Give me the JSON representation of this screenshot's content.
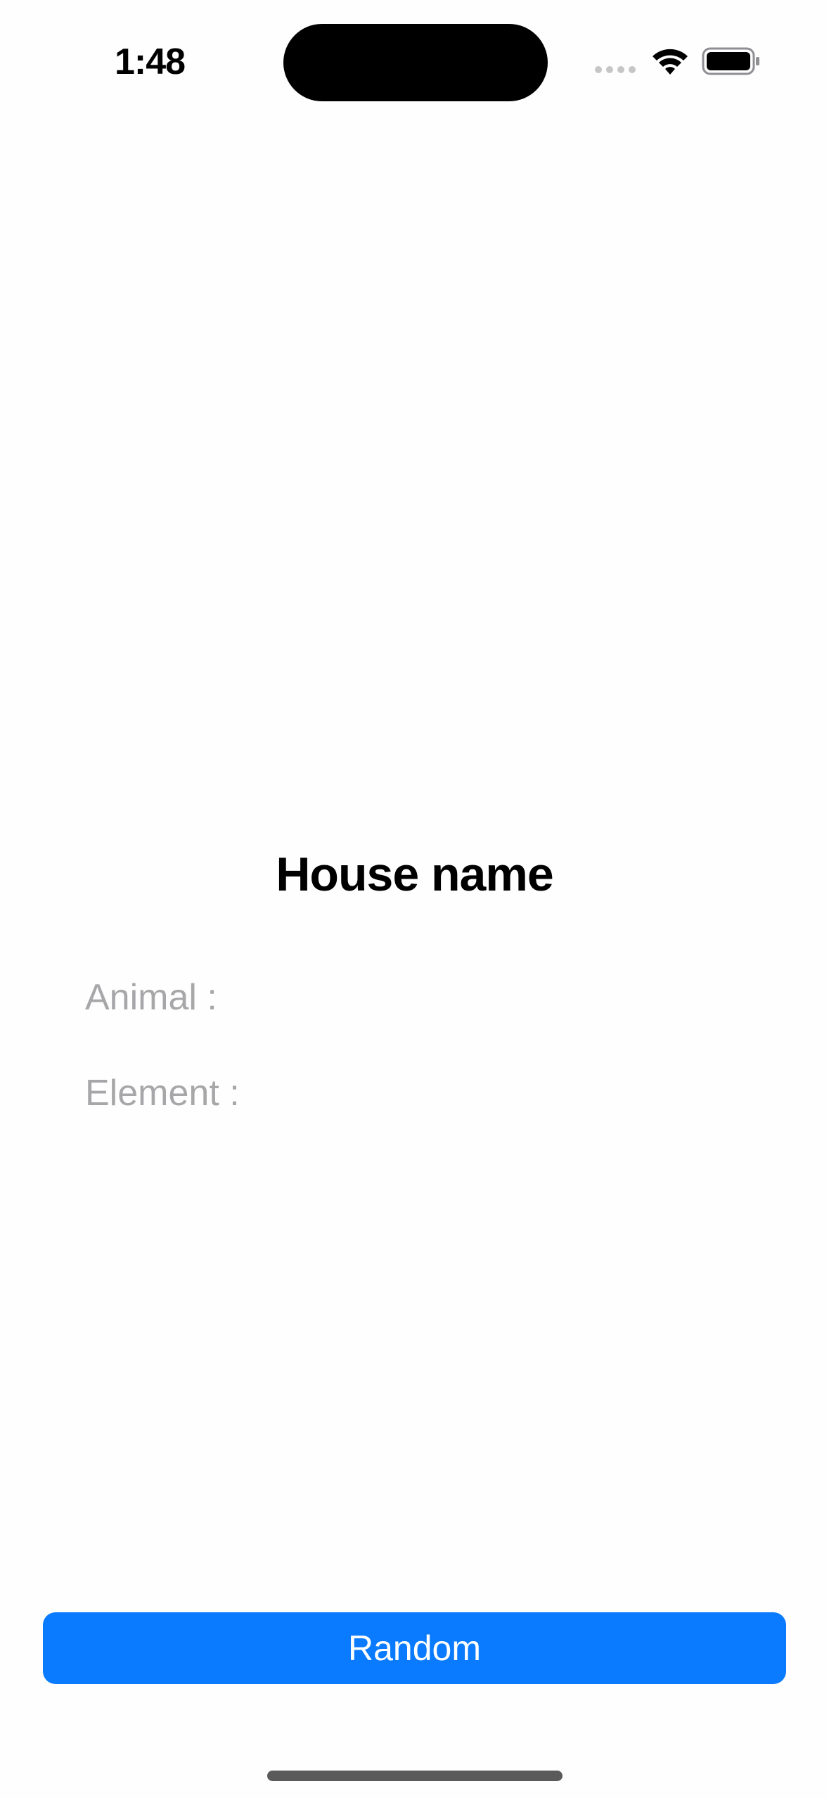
{
  "status_bar": {
    "time": "1:48",
    "icons": [
      "cellular-signal-icon",
      "wifi-icon",
      "battery-icon"
    ]
  },
  "main": {
    "title": "House name",
    "animal_label": "Animal :",
    "element_label": "Element :"
  },
  "actions": {
    "random_label": "Random"
  },
  "colors": {
    "accent": "#0a7afe",
    "label_gray": "#a7a7a9",
    "background": "#fefefe"
  }
}
